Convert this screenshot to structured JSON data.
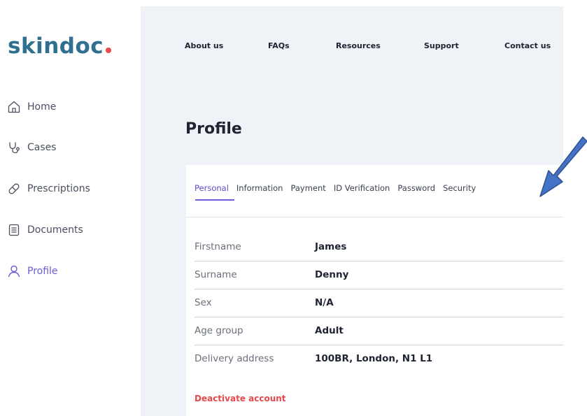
{
  "brand": {
    "name": "skindoc",
    "accent": "#e5484d",
    "color": "#2f6f8f"
  },
  "sidebar": {
    "items": [
      {
        "label": "Home",
        "icon": "home-icon"
      },
      {
        "label": "Cases",
        "icon": "stethoscope-icon"
      },
      {
        "label": "Prescriptions",
        "icon": "pill-icon"
      },
      {
        "label": "Documents",
        "icon": "document-icon"
      },
      {
        "label": "Profile",
        "icon": "user-icon",
        "active": true
      }
    ]
  },
  "topnav": {
    "links": [
      "About us",
      "FAQs",
      "Resources",
      "Support",
      "Contact us"
    ]
  },
  "page": {
    "title": "Profile"
  },
  "tabs": {
    "items": [
      "Personal",
      "Information",
      "Payment",
      "ID Verification",
      "Password",
      "Security"
    ],
    "active": "Personal"
  },
  "profile": {
    "rows": [
      {
        "label": "Firstname",
        "value": "James"
      },
      {
        "label": "Surname",
        "value": "Denny"
      },
      {
        "label": "Sex",
        "value": "N/A"
      },
      {
        "label": "Age group",
        "value": "Adult"
      },
      {
        "label": "Delivery address",
        "value": "100BR, London, N1 L1"
      }
    ]
  },
  "actions": {
    "deactivate_label": "Deactivate account"
  },
  "colors": {
    "accent_purple": "#6a5cd6",
    "panel_bg": "#eff3f8",
    "danger": "#e5484d",
    "annotation_arrow": "#4472c4"
  }
}
